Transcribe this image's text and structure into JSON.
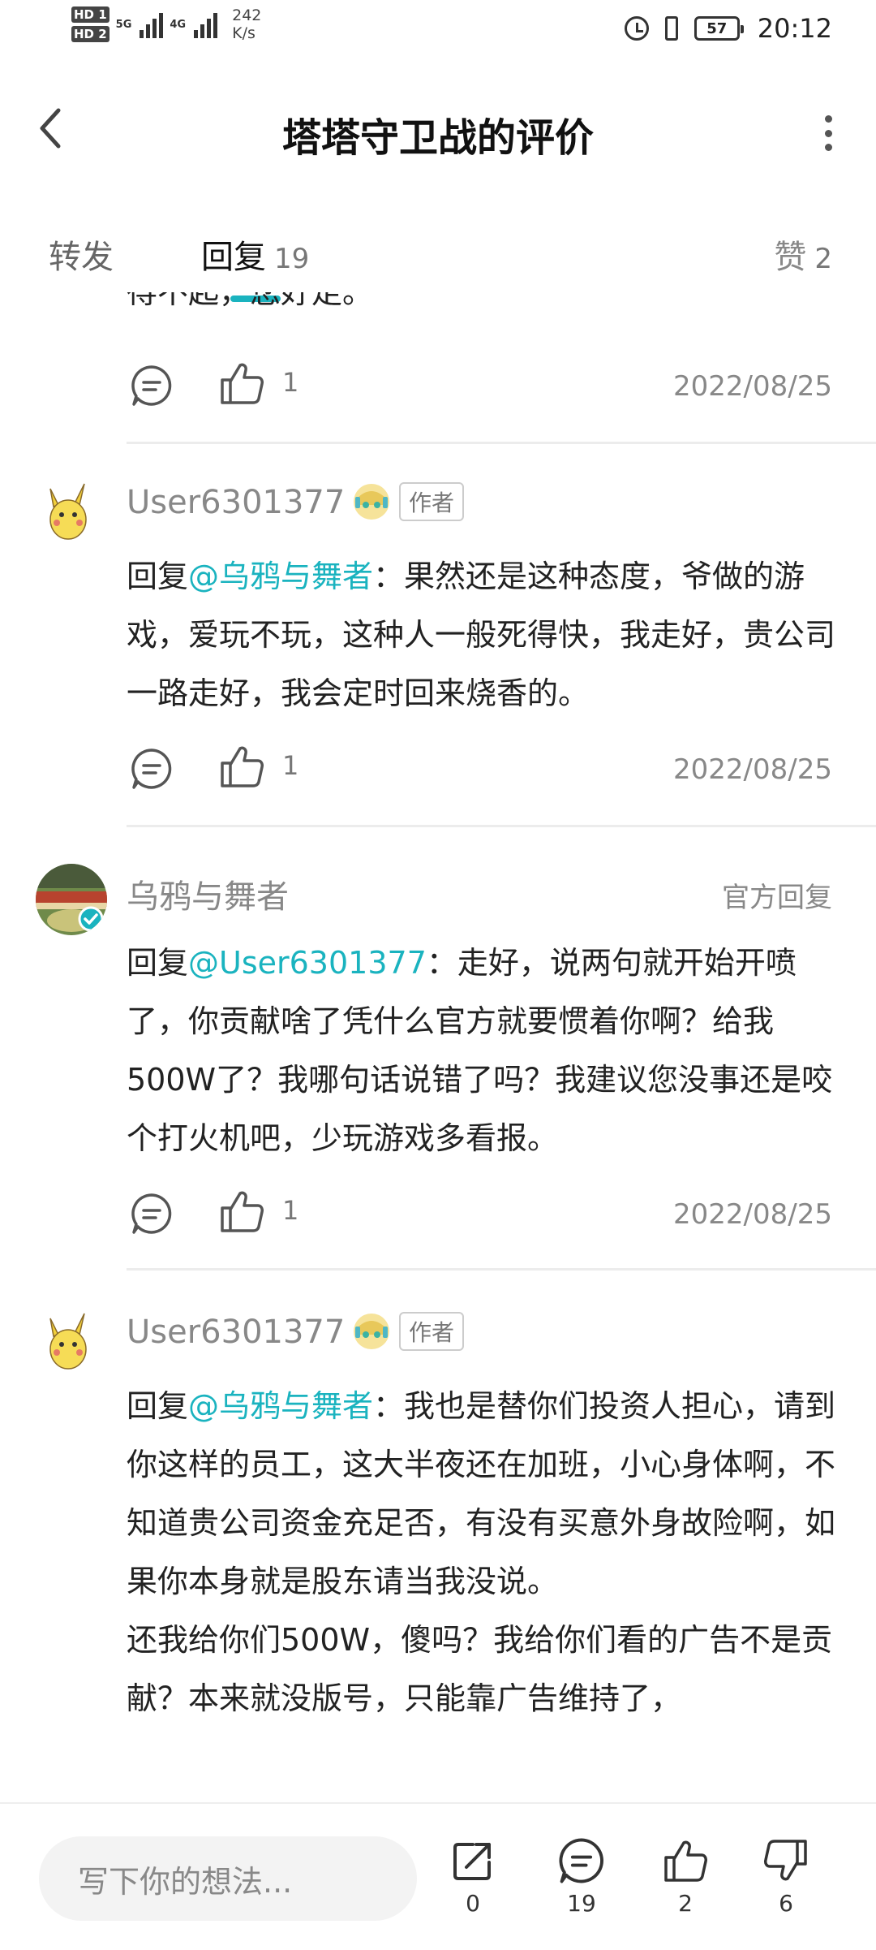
{
  "status_bar": {
    "net1": "5G",
    "net2": "4G",
    "speed_value": "242",
    "speed_unit": "K/s",
    "battery": "57",
    "time": "20:12"
  },
  "header": {
    "title": "塔塔守卫战的评价"
  },
  "tabs": {
    "forward_label": "转发",
    "reply_label": "回复",
    "reply_count": "19",
    "likes_label": "赞",
    "likes_count": "2"
  },
  "fragment": {
    "text": "得不起，您好走。",
    "like_count": "1",
    "date": "2022/08/25"
  },
  "comments": [
    {
      "username": "User6301377",
      "tag": "作者",
      "reply_prefix": "回复",
      "mention": "@乌鸦与舞者",
      "text": "：果然还是这种态度，爷做的游戏，爱玩不玩，这种人一般死得快，我走好，贵公司一路走好，我会定时回来烧香的。",
      "like_count": "1",
      "date": "2022/08/25"
    },
    {
      "username": "乌鸦与舞者",
      "tag": "官方回复",
      "reply_prefix": "回复",
      "mention": "@User6301377",
      "text": "：走好，说两句就开始开喷了，你贡献啥了凭什么官方就要惯着你啊？给我500W了？我哪句话说错了吗？我建议您没事还是咬个打火机吧，少玩游戏多看报。",
      "like_count": "1",
      "date": "2022/08/25"
    },
    {
      "username": "User6301377",
      "tag": "作者",
      "reply_prefix": "回复",
      "mention": "@乌鸦与舞者",
      "text": "：我也是替你们投资人担心，请到你这样的员工，这大半夜还在加班，小心身体啊，不知道贵公司资金充足否，有没有买意外身故险啊，如果你本身就是股东请当我没说。",
      "text2": "还我给你们500W，傻吗？我给你们看的广告不是贡献？本来就没版号，只能靠广告维持了，"
    }
  ],
  "bottom_bar": {
    "input_placeholder": "写下你的想法...",
    "share_count": "0",
    "comment_count": "19",
    "like_count": "2",
    "dislike_count": "6"
  },
  "colors": {
    "accent": "#1ab3bf",
    "text": "#222222",
    "muted": "#888888"
  },
  "icons": [
    "back-icon",
    "more-icon",
    "comment-icon",
    "like-icon",
    "share-icon",
    "dislike-icon",
    "alarm-icon",
    "vibrate-icon",
    "battery-icon"
  ]
}
